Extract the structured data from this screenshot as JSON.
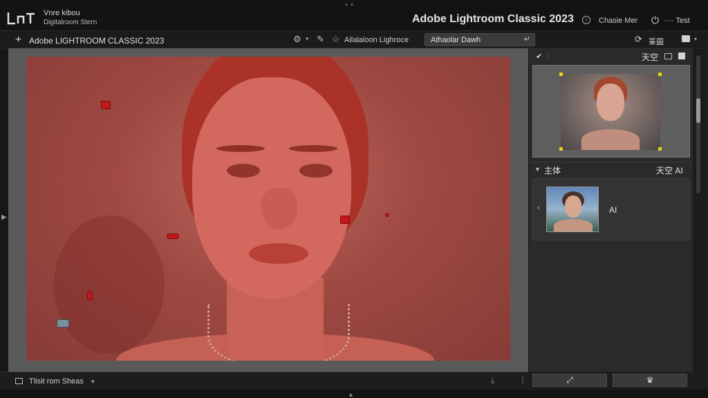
{
  "header": {
    "brand_line1": "Vnre kibou",
    "brand_line2": "Digitalroom Stern",
    "handle_dots": "• •",
    "app_title": "Adobe Lightroom Classic 2023",
    "info_icon": "info-icon",
    "info_label": "Chasie Mer",
    "power_icon": "power-icon",
    "user_label": "···· Test"
  },
  "toolbar": {
    "add_icon": "plus-icon",
    "module_title": "Adobe LIGHTROOM CLASSIC 2023",
    "tool_label": "Ailalaloon Lighroce",
    "preset_value": "Athaolar Dawh",
    "panel_label": "篆圖"
  },
  "right_panel": {
    "mask_title": "天空",
    "subject_header": "主体",
    "subject_header_right": "天空 AI",
    "subject_item_label": "AI"
  },
  "bottom_bar": {
    "view_label": "Tlisit rom Sheas"
  },
  "colors": {
    "mask_overlay": "#c81e14",
    "pin_color": "#c4171a",
    "corner_handle": "#e8d21a",
    "panel_bg": "#2a2a2a"
  }
}
